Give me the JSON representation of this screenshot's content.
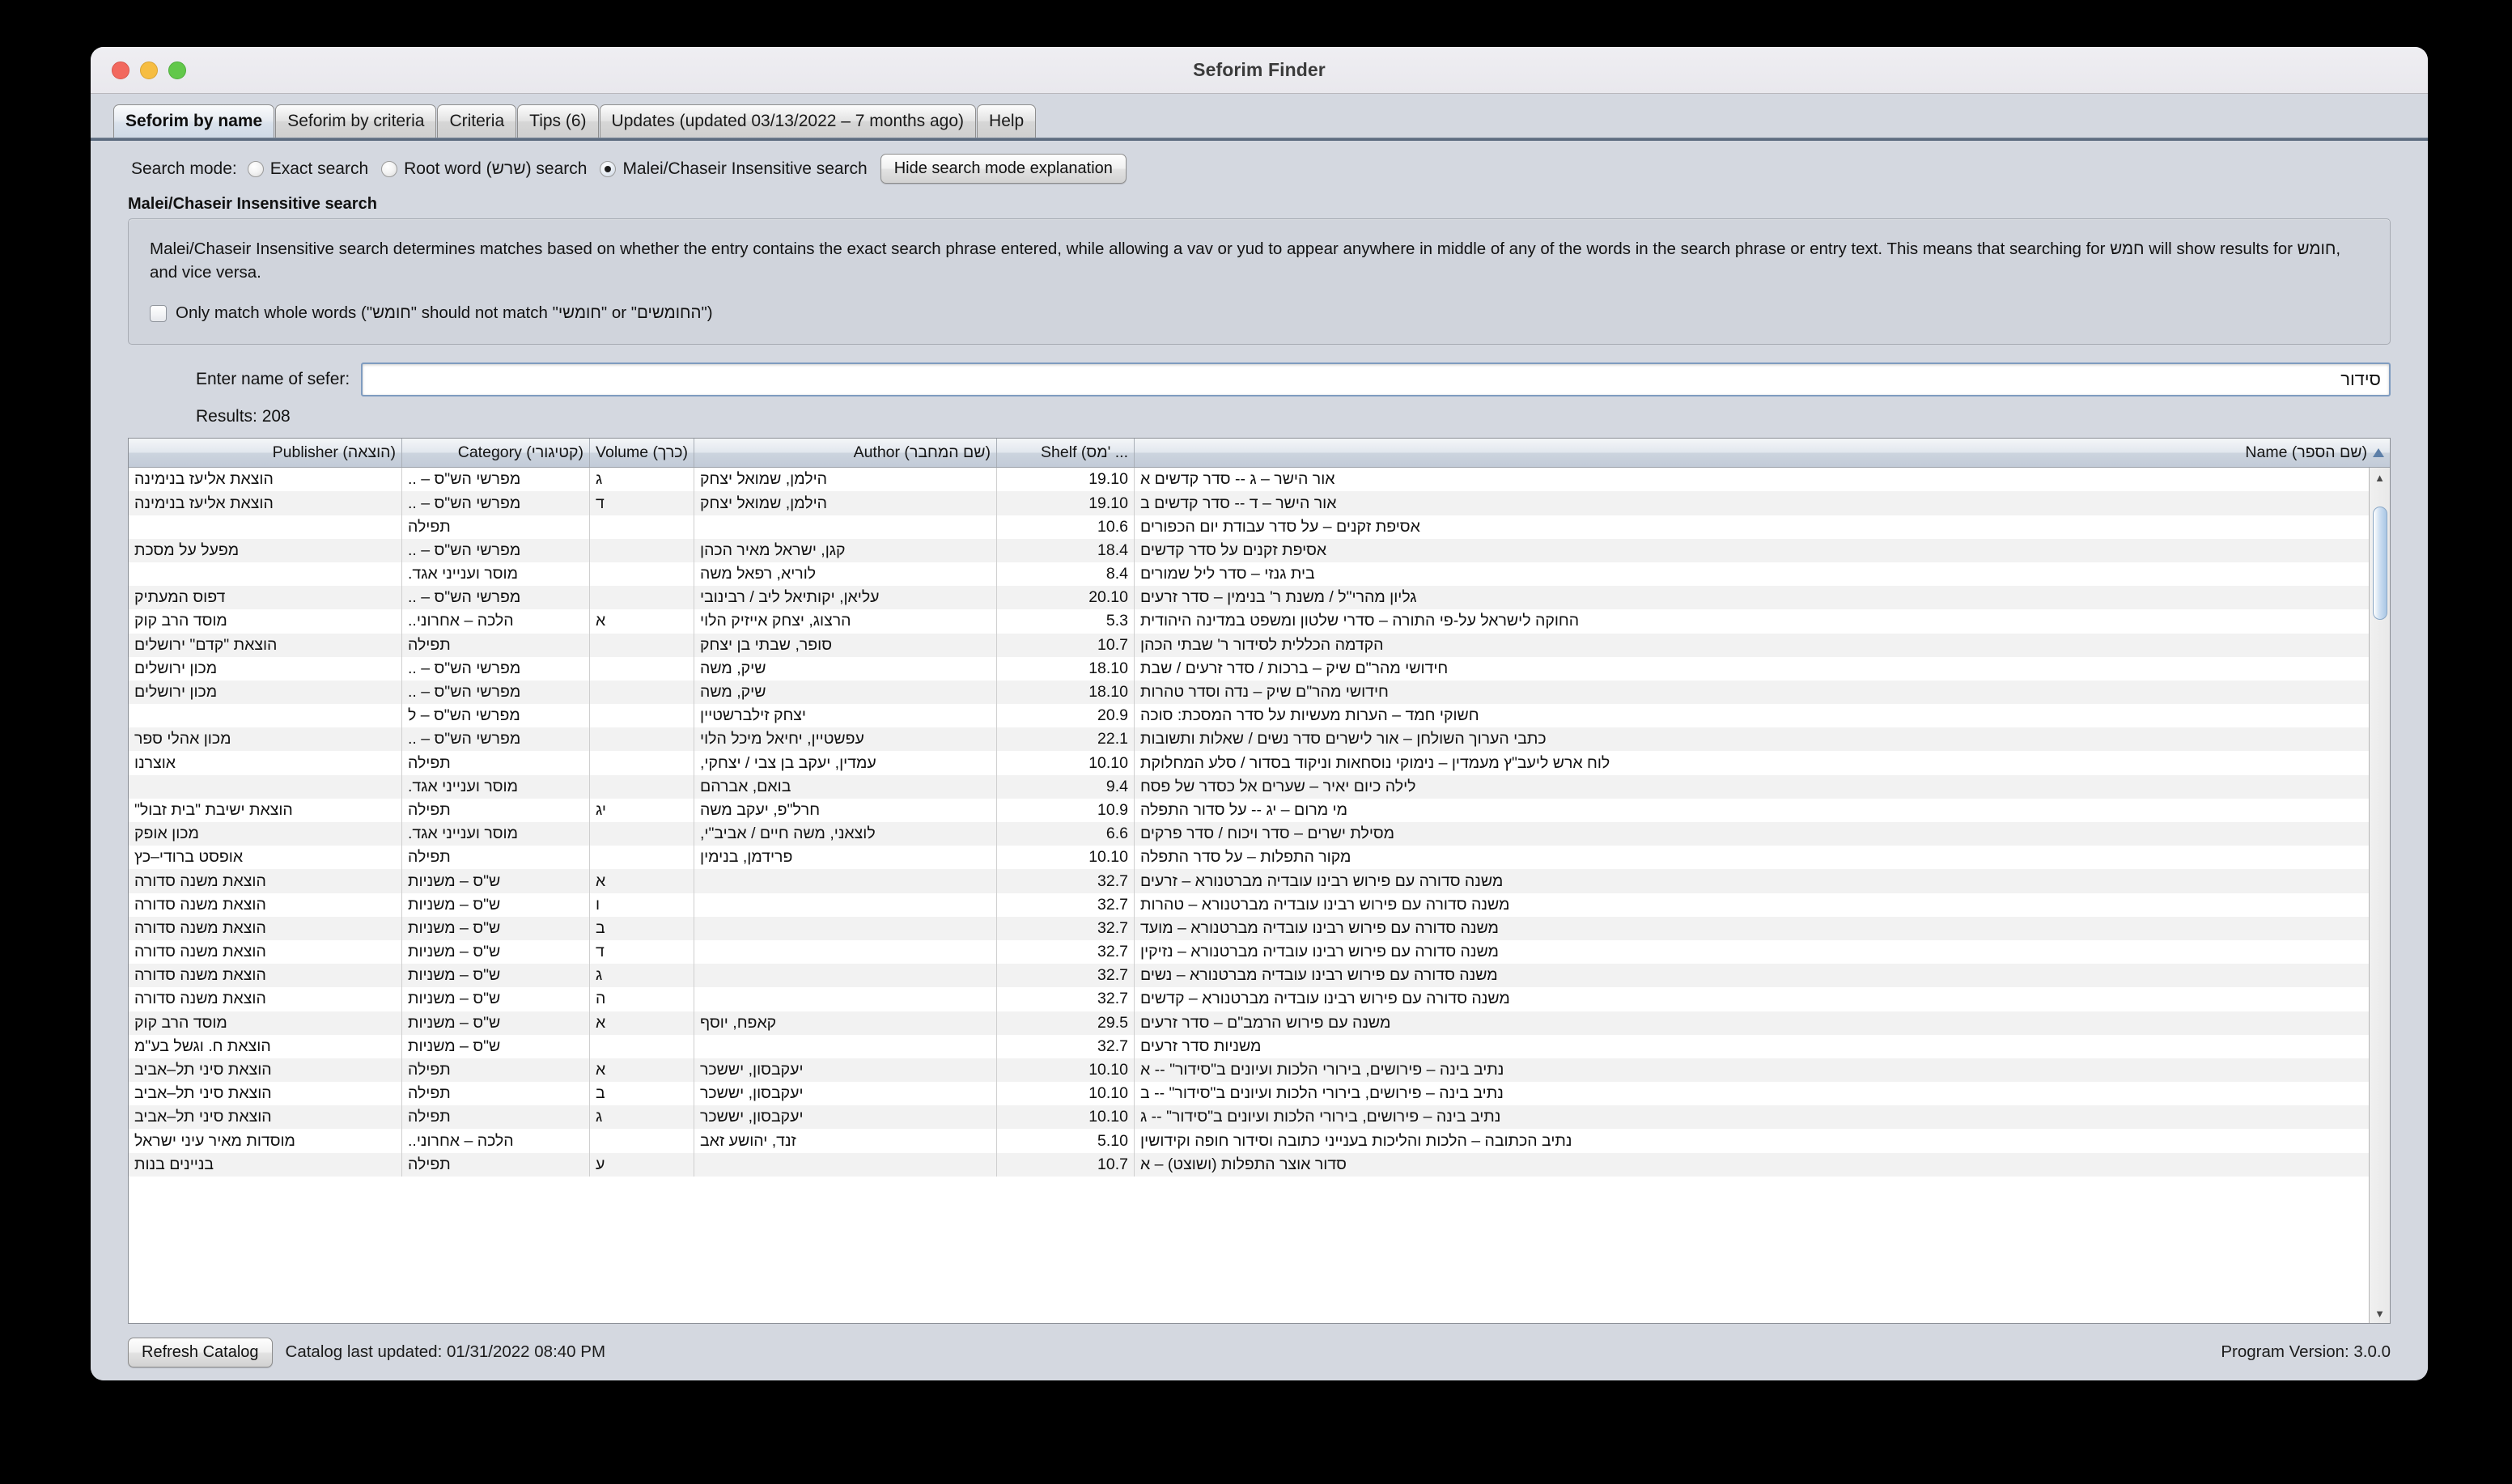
{
  "window": {
    "title": "Seforim Finder"
  },
  "tabs": [
    {
      "label": "Seforim by name",
      "active": true
    },
    {
      "label": "Seforim by criteria",
      "active": false
    },
    {
      "label": "Criteria",
      "active": false
    },
    {
      "label": "Tips (6)",
      "active": false
    },
    {
      "label": "Updates (updated 03/13/2022 – 7 months ago)",
      "active": false
    },
    {
      "label": "Help",
      "active": false
    }
  ],
  "search_mode": {
    "label": "Search mode:",
    "options": [
      {
        "label": "Exact search",
        "checked": false
      },
      {
        "label": "Root word (שרש) search",
        "checked": false
      },
      {
        "label": "Malei/Chaseir Insensitive search",
        "checked": true
      }
    ],
    "toggle_button": "Hide search mode explanation"
  },
  "explanation": {
    "title": "Malei/Chaseir Insensitive search",
    "body": "Malei/Chaseir Insensitive search determines matches based on whether the entry contains the exact search phrase entered, while allowing a vav or yud to appear anywhere in middle of any of the words in the search phrase or entry text. This means that searching for חמש will show results for חומש, and vice versa.",
    "whole_words_checkbox": {
      "label": "Only match whole words (\"חומש\" should not match \"חומשי\" or \"החומשים\")",
      "checked": false
    }
  },
  "search": {
    "label": "Enter name of sefer:",
    "value": "סידור",
    "placeholder": "",
    "results_label": "Results: 208"
  },
  "table": {
    "columns": [
      {
        "key": "publisher",
        "label": "Publisher (הוצאה)"
      },
      {
        "key": "category",
        "label": "Category (קטיגורי)"
      },
      {
        "key": "volume",
        "label": "Volume (כרך)"
      },
      {
        "key": "author",
        "label": "Author (שם המחבר)"
      },
      {
        "key": "shelf",
        "label": "Shelf (מס' ..."
      },
      {
        "key": "name",
        "label": "Name (שם הספר)",
        "sorted": "asc"
      }
    ],
    "rows": [
      {
        "publisher": "הוצאת אליעז בנימינה",
        "category": "מפרשי הש\"ס – ..",
        "volume": "ג",
        "author": "הילמן, שמואל יצחק",
        "shelf": "19.10",
        "name": "אור הישר – ג -- סדר קדשים א"
      },
      {
        "publisher": "הוצאת אליעז בנימינה",
        "category": "מפרשי הש\"ס – ..",
        "volume": "ד",
        "author": "הילמן, שמואל יצחק",
        "shelf": "19.10",
        "name": "אור הישר – ד -- סדר קדשים ב"
      },
      {
        "publisher": "",
        "category": "תפילה",
        "volume": "",
        "author": "",
        "shelf": "10.6",
        "name": "אסיפת זקנים – על סדר עבודת יום הכפורים"
      },
      {
        "publisher": "מפעל על מסכת",
        "category": "מפרשי הש\"ס – ..",
        "volume": "",
        "author": "קגן, ישראל מאיר הכהן",
        "shelf": "18.4",
        "name": "אסיפת זקנים על סדר קדשים"
      },
      {
        "publisher": "",
        "category": "מוסר וענייני אגד.",
        "volume": "",
        "author": "לוריא, רפאל משה",
        "shelf": "8.4",
        "name": "בית גנזי – סדר ליל שמורים"
      },
      {
        "publisher": "דפוס המעתיק",
        "category": "מפרשי הש\"ס – ..",
        "volume": "",
        "author": "עליאן, יקותיאל ליב / רבינובי",
        "shelf": "20.10",
        "name": "גליון מהרי\"ל / משנת ר' בנימין – סדר זרעים"
      },
      {
        "publisher": "מוסד הרב קוק",
        "category": "הלכה – אחרוני..",
        "volume": "א",
        "author": "הרצוג, יצחק אייזיק הלוי",
        "shelf": "5.3",
        "name": "החוקה לישראל על-פי התורה – סדרי שלטון ומשפט במדינה היהודית"
      },
      {
        "publisher": "הוצאת \"קדם\" ירושלים",
        "category": "תפילה",
        "volume": "",
        "author": "סופר, שבתי בן יצחק",
        "shelf": "10.7",
        "name": "הקדמה הכללית לסידור ר' שבתי הכהן"
      },
      {
        "publisher": "מכון ירושלים",
        "category": "מפרשי הש\"ס – ..",
        "volume": "",
        "author": "שיק, משה",
        "shelf": "18.10",
        "name": "חידושי מהר\"ם שיק – ברכות / סדר זרעים / שבת"
      },
      {
        "publisher": "מכון ירושלים",
        "category": "מפרשי הש\"ס – ..",
        "volume": "",
        "author": "שיק, משה",
        "shelf": "18.10",
        "name": "חידושי מהר\"ם שיק – נדה וסדר טהרות"
      },
      {
        "publisher": "",
        "category": "מפרשי הש\"ס – ל",
        "volume": "",
        "author": "יצחק זילברשטיין",
        "shelf": "20.9",
        "name": "חשוקי חמד – הערות מעשיות על סדר המסכת: סוכה"
      },
      {
        "publisher": "מכון אהלי ספר",
        "category": "מפרשי הש\"ס – ..",
        "volume": "",
        "author": "עפשטיין, יחיאל מיכל הלוי",
        "shelf": "22.1",
        "name": "כתבי הערוך השולחן – אור לישרים סדר נשים / שאלות ותשובות"
      },
      {
        "publisher": "אוצרנו",
        "category": "תפילה",
        "volume": "",
        "author": "עמדין, יעקב בן צבי / יצחקי,",
        "shelf": "10.10",
        "name": "לוח ארש ליעב\"ץ מעמדין – נימוקי נוסחאות וניקוד בסדור / סלע המחלוקת"
      },
      {
        "publisher": "",
        "category": "מוסר וענייני אגד.",
        "volume": "",
        "author": "בואם, אברהם",
        "shelf": "9.4",
        "name": "לילה כיום יאיר – שערים אל כסדר של פסח"
      },
      {
        "publisher": "הוצאת ישיבת \"בית זבול\"",
        "category": "תפילה",
        "volume": "יג",
        "author": "חרל\"פ, יעקב משה",
        "shelf": "10.9",
        "name": "מי מרום – יג -- על סדור התפלה"
      },
      {
        "publisher": "מכון אופק",
        "category": "מוסר וענייני אגד.",
        "volume": "",
        "author": "לוצאני, משה חיים / אביב\"י,",
        "shelf": "6.6",
        "name": "מסילת ישרים – סדר ויכוח / סדר פרקים"
      },
      {
        "publisher": "אופסט ברודי–כץ",
        "category": "תפילה",
        "volume": "",
        "author": "פרידמן, בנימין",
        "shelf": "10.10",
        "name": "מקור התפלות – על סדר התפלה"
      },
      {
        "publisher": "הוצאת משנה סדורה",
        "category": "ש\"ס – משניות",
        "volume": "א",
        "author": "",
        "shelf": "32.7",
        "name": "משנה סדורה עם פירוש רבינו עובדיה מברטנורא – זרעים"
      },
      {
        "publisher": "הוצאת משנה סדורה",
        "category": "ש\"ס – משניות",
        "volume": "ו",
        "author": "",
        "shelf": "32.7",
        "name": "משנה סדורה עם פירוש רבינו עובדיה מברטנורא – טהרות"
      },
      {
        "publisher": "הוצאת משנה סדורה",
        "category": "ש\"ס – משניות",
        "volume": "ב",
        "author": "",
        "shelf": "32.7",
        "name": "משנה סדורה עם פירוש רבינו עובדיה מברטנורא – מועד"
      },
      {
        "publisher": "הוצאת משנה סדורה",
        "category": "ש\"ס – משניות",
        "volume": "ד",
        "author": "",
        "shelf": "32.7",
        "name": "משנה סדורה עם פירוש רבינו עובדיה מברטנורא – נזיקין"
      },
      {
        "publisher": "הוצאת משנה סדורה",
        "category": "ש\"ס – משניות",
        "volume": "ג",
        "author": "",
        "shelf": "32.7",
        "name": "משנה סדורה עם פירוש רבינו עובדיה מברטנורא – נשים"
      },
      {
        "publisher": "הוצאת משנה סדורה",
        "category": "ש\"ס – משניות",
        "volume": "ה",
        "author": "",
        "shelf": "32.7",
        "name": "משנה סדורה עם פירוש רבינו עובדיה מברטנורא – קדשים"
      },
      {
        "publisher": "מוסד הרב קוק",
        "category": "ש\"ס – משניות",
        "volume": "א",
        "author": "קאפח, יוסף",
        "shelf": "29.5",
        "name": "משנה עם פירוש הרמב\"ם – סדר זרעים"
      },
      {
        "publisher": "הוצאת ח. וגשל בע\"מ",
        "category": "ש\"ס – משניות",
        "volume": "",
        "author": "",
        "shelf": "32.7",
        "name": "משניות סדר זרעים"
      },
      {
        "publisher": "הוצאת סיני תל–אביב",
        "category": "תפילה",
        "volume": "א",
        "author": "יעקבסון, יששכר",
        "shelf": "10.10",
        "name": "נתיב בינה – פירושים, בירורי הלכות ועיונים ב\"סידור\" -- א"
      },
      {
        "publisher": "הוצאת סיני תל–אביב",
        "category": "תפילה",
        "volume": "ב",
        "author": "יעקבסון, יששכר",
        "shelf": "10.10",
        "name": "נתיב בינה – פירושים, בירורי הלכות ועיונים ב\"סידור\" -- ב"
      },
      {
        "publisher": "הוצאת סיני תל–אביב",
        "category": "תפילה",
        "volume": "ג",
        "author": "יעקבסון, יששכר",
        "shelf": "10.10",
        "name": "נתיב בינה – פירושים, בירורי הלכות ועיונים ב\"סידור\" -- ג"
      },
      {
        "publisher": "מוסדות מאיר עיני ישראל",
        "category": "הלכה – אחרוני..",
        "volume": "",
        "author": "זנד, יהושע זאב",
        "shelf": "5.10",
        "name": "נתיב הכתובה – הלכות והליכות בענייני כתובה וסידור חופה וקידושין"
      },
      {
        "publisher": "בניינים בנות",
        "category": "תפילה",
        "volume": "ע",
        "author": "",
        "shelf": "10.7",
        "name": "סדור אוצר התפלות (ושוצט) – א"
      }
    ]
  },
  "status": {
    "refresh_button": "Refresh Catalog",
    "catalog_updated": "Catalog last updated: 01/31/2022 08:40 PM",
    "version": "Program Version: 3.0.0"
  },
  "icons": {
    "scroll_up": "▲",
    "scroll_down": "▼"
  }
}
